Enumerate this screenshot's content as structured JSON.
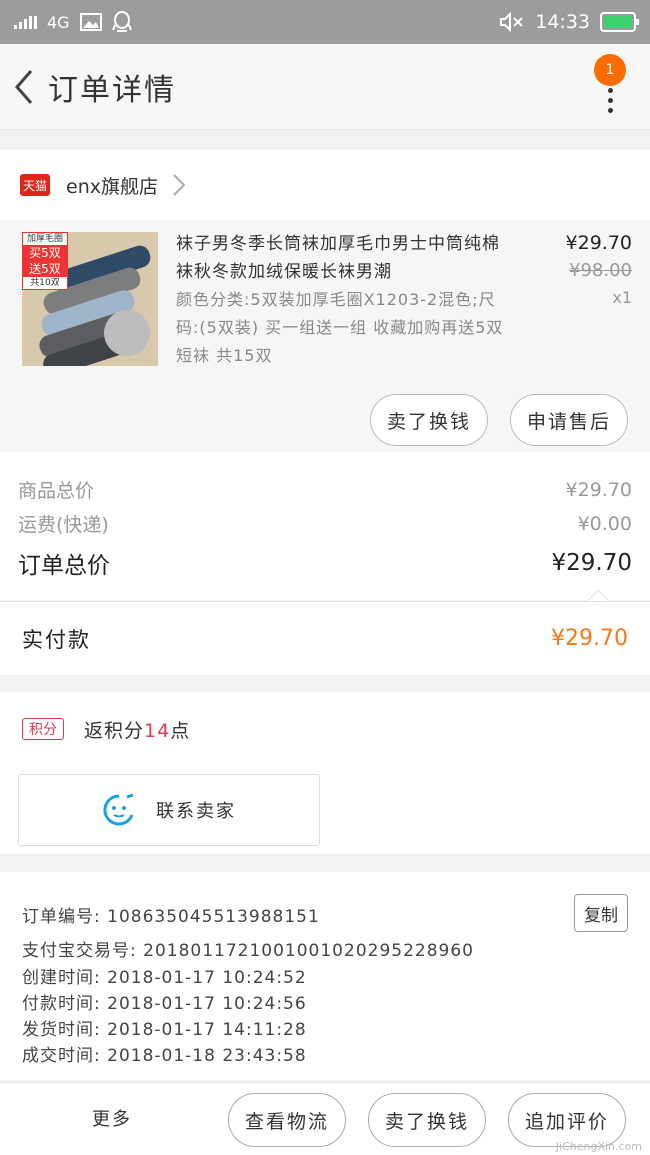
{
  "status_bar": {
    "network": "4G",
    "time": "14:33"
  },
  "nav": {
    "title": "订单详情",
    "badge_count": "1"
  },
  "shop": {
    "platform_logo": "天猫",
    "name": "enx旗舰店"
  },
  "item": {
    "title": "袜子男冬季长筒袜加厚毛巾男士中筒纯棉袜秋冬款加绒保暖长袜男潮",
    "sku": "颜色分类:5双装加厚毛圈X1203-2混色;尺码:(5双装) 买一组送一组 收藏加购再送5双短袜 共15双",
    "price": "¥29.70",
    "original_price": "¥98.00",
    "quantity": "x1",
    "thumb_tag": [
      "加厚毛圈",
      "买5双",
      "送5双",
      "共10双"
    ],
    "actions": [
      "卖了换钱",
      "申请售后"
    ]
  },
  "summary": {
    "goods_total_label": "商品总价",
    "goods_total": "¥29.70",
    "shipping_label": "运费(快递)",
    "shipping": "¥0.00",
    "order_total_label": "订单总价",
    "order_total": "¥29.70",
    "paid_label": "实付款",
    "paid": "¥29.70"
  },
  "points": {
    "tag": "积分",
    "prefix": "返积分",
    "value": "14",
    "suffix": "点"
  },
  "contact": {
    "label": "联系卖家"
  },
  "order_info": {
    "order_no": "订单编号: 108635045513988151",
    "alipay_no": "支付宝交易号: 2018011721001001020295228960",
    "created": "创建时间: 2018-01-17 10:24:52",
    "paid_time": "付款时间: 2018-01-17 10:24:56",
    "shipped": "发货时间: 2018-01-17 14:11:28",
    "completed": "成交时间: 2018-01-18 23:43:58",
    "copy_label": "复制"
  },
  "bottom_bar": {
    "more": "更多",
    "logistics": "查看物流",
    "sell": "卖了换钱",
    "review": "追加评价"
  },
  "watermark": "JiChengXin.com",
  "colors": {
    "accent_orange": "#f27a1a",
    "points_red": "#e03c50",
    "tmall_red": "#e2231a",
    "badge_orange": "#ff6b00"
  }
}
